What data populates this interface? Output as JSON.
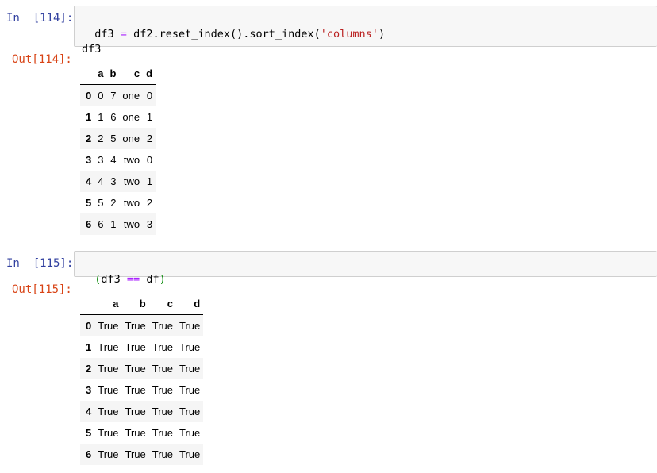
{
  "cells": [
    {
      "in_prompt": "In  [114]:",
      "code_line1_var": "df3",
      "code_line1_eq": "=",
      "code_line1_call": "df2.reset_index().sort_index(",
      "code_line1_str": "'columns'",
      "code_line1_end": ")",
      "code_line2": "df3",
      "out_prompt": "Out[114]:",
      "table": {
        "columns": [
          "",
          "a",
          "b",
          "c",
          "d"
        ],
        "rows": [
          [
            "0",
            "0",
            "7",
            "one",
            "0"
          ],
          [
            "1",
            "1",
            "6",
            "one",
            "1"
          ],
          [
            "2",
            "2",
            "5",
            "one",
            "2"
          ],
          [
            "3",
            "3",
            "4",
            "two",
            "0"
          ],
          [
            "4",
            "4",
            "3",
            "two",
            "1"
          ],
          [
            "5",
            "5",
            "2",
            "two",
            "2"
          ],
          [
            "6",
            "6",
            "1",
            "two",
            "3"
          ]
        ]
      }
    },
    {
      "in_prompt": "In  [115]:",
      "code_open": "(",
      "code_a": "df3 ",
      "code_eq": "==",
      "code_b": " df",
      "code_close": ")",
      "out_prompt": "Out[115]:",
      "table": {
        "columns": [
          "",
          "a",
          "b",
          "c",
          "d"
        ],
        "rows": [
          [
            "0",
            "True",
            "True",
            "True",
            "True"
          ],
          [
            "1",
            "True",
            "True",
            "True",
            "True"
          ],
          [
            "2",
            "True",
            "True",
            "True",
            "True"
          ],
          [
            "3",
            "True",
            "True",
            "True",
            "True"
          ],
          [
            "4",
            "True",
            "True",
            "True",
            "True"
          ],
          [
            "5",
            "True",
            "True",
            "True",
            "True"
          ],
          [
            "6",
            "True",
            "True",
            "True",
            "True"
          ]
        ]
      }
    }
  ]
}
